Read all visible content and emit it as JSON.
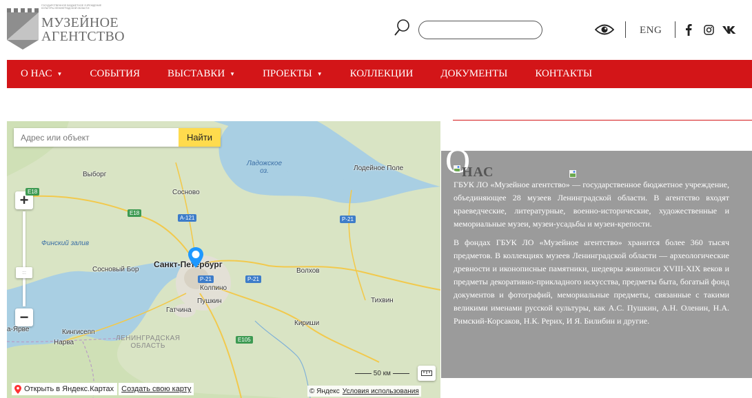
{
  "header": {
    "logo": {
      "small_text": "Государственное бюджетное учреждение культуры Ленинградской области",
      "line1": "МУЗЕЙНОЕ",
      "line2": "АГЕНТСТВО"
    },
    "search": {
      "placeholder": "",
      "value": ""
    },
    "accessibility_icon": "eye-icon",
    "language": "ENG",
    "social": [
      "facebook-icon",
      "instagram-icon",
      "vk-icon"
    ]
  },
  "nav": {
    "items": [
      {
        "label": "О НАС",
        "dropdown": true
      },
      {
        "label": "СОБЫТИЯ",
        "dropdown": false
      },
      {
        "label": "ВЫСТАВКИ",
        "dropdown": true
      },
      {
        "label": "ПРОЕКТЫ",
        "dropdown": true
      },
      {
        "label": "КОЛЛЕКЦИИ",
        "dropdown": false
      },
      {
        "label": "ДОКУМЕНТЫ",
        "dropdown": false
      },
      {
        "label": "КОНТАКТЫ",
        "dropdown": false
      }
    ],
    "caret": "▼"
  },
  "map": {
    "search_placeholder": "Адрес или объект",
    "search_button": "Найти",
    "zoom_in": "+",
    "zoom_out": "−",
    "labels": {
      "ladoga": "Ладожское\nоз.",
      "lodeynoe_pole": "Лодейное Поле",
      "vyborg": "Выборг",
      "sosnovo": "Сосново",
      "finnish_gulf": "Финский залив",
      "sosnovy_bor": "Сосновый Бор",
      "spb": "Санкт-Петербург",
      "kolpino": "Колпино",
      "pushkin": "Пушкин",
      "gatchina": "Гатчина",
      "volkhov": "Волхов",
      "tikhvin": "Тихвин",
      "kirishi": "Кириши",
      "kingisepp": "Кингисепп",
      "narva": "Нарва",
      "yarve": "а-Ярве",
      "region": "ЛЕНИНГРАДСКАЯ\nОБЛАСТЬ"
    },
    "roads": {
      "e18a": "E18",
      "e18b": "E18",
      "a121": "A-121",
      "p21a": "P-21",
      "p21b": "P-21",
      "p21c": "P-21",
      "e105": "E105"
    },
    "scale": "50 км",
    "open_link": "Открыть в Яндекс.Картах",
    "create_link": "Создать свою карту",
    "copyright": "© Яндекс",
    "terms": "Условия использования"
  },
  "about": {
    "big_letter": "О",
    "heading": "НАС",
    "paragraphs": [
      "ГБУК ЛО «Музейное агентство» — государственное бюджетное учреждение, объединяющее 28 музеев Ленинградской области. В агентство входят краеведческие, литературные, военно-исторические, художественные и мемориальные музеи, музеи-усадьбы и музеи-крепости.",
      "В фондах ГБУК ЛО «Музейное агентство» хранится более 360 тысяч предметов. В коллекциях музеев Ленинградской области — археологические древности и иконописные памятники, шедевры живописи XVIII-XIX веков и предметы декоративно-прикладного искусства, предметы быта, богатый фонд документов и фотографий, мемориальные предметы, связанные с такими великими именами русской культуры, как А.С. Пушкин, А.Н. Оленин, Н.А. Римский-Корсаков, Н.К. Рерих, И Я. Билибин и другие."
    ]
  },
  "colors": {
    "brand_red": "#d31518",
    "panel_gray": "#9b9b9b",
    "map_button_yellow": "#ffdb4d"
  }
}
